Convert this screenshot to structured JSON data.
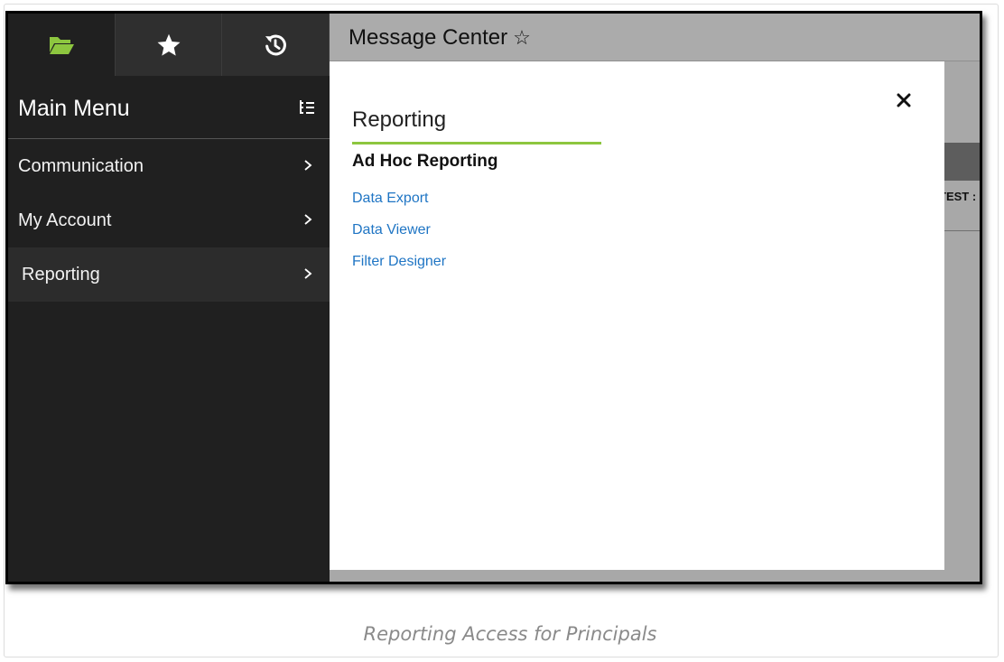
{
  "sidebar": {
    "tabs": [
      {
        "name": "folder-open-icon",
        "color": "#8dc63f",
        "active": true
      },
      {
        "name": "star-icon",
        "color": "#ffffff",
        "active": false
      },
      {
        "name": "history-icon",
        "color": "#ffffff",
        "active": false
      }
    ],
    "menu_title": "Main Menu",
    "items": [
      {
        "label": "Communication"
      },
      {
        "label": "My Account"
      },
      {
        "label": "Reporting"
      }
    ]
  },
  "app_header": {
    "title": "Message Center",
    "star": "☆"
  },
  "background": {
    "column_fragment": "TEST :"
  },
  "flyout": {
    "title": "Reporting",
    "section_heading": "Ad Hoc Reporting",
    "links": [
      {
        "label": "Data Export"
      },
      {
        "label": "Data Viewer"
      },
      {
        "label": "Filter Designer"
      }
    ],
    "close_symbol": "×"
  },
  "caption": "Reporting Access for Principals",
  "colors": {
    "accent_green": "#8dc63f",
    "link_blue": "#1f75c4",
    "sidebar_bg": "#202020"
  }
}
